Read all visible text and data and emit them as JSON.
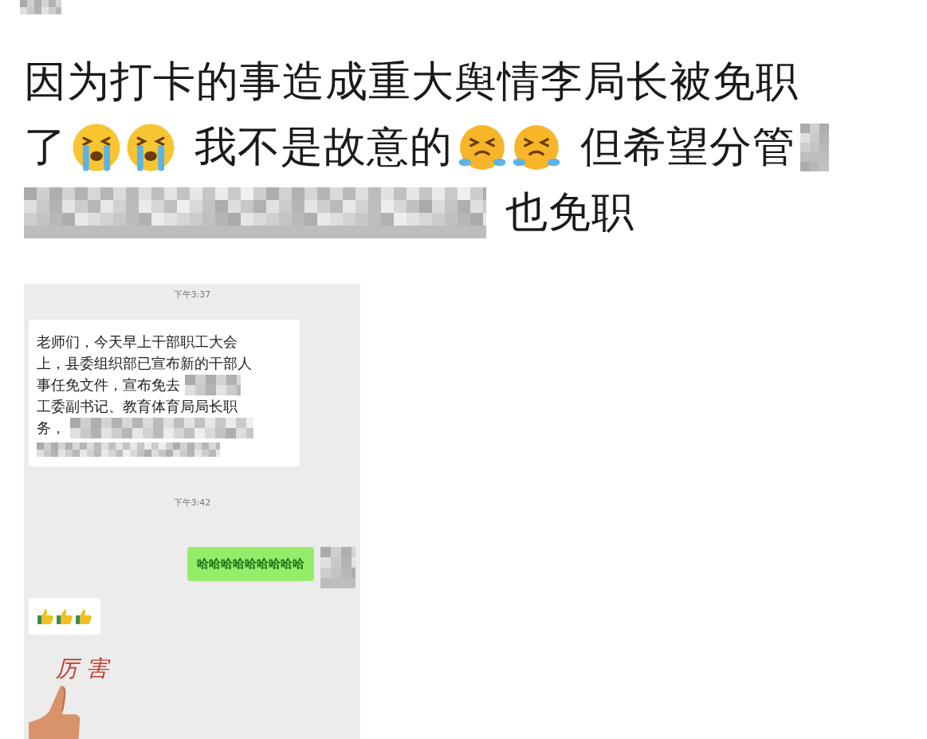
{
  "post": {
    "lines": [
      [
        {
          "kind": "text",
          "text": "因为打卡的事造成重大舆情李局长被免职"
        }
      ],
      [
        {
          "kind": "text",
          "text": "了"
        },
        {
          "kind": "crying"
        },
        {
          "kind": "crying"
        },
        {
          "kind": "text",
          "text": "我不是故意的"
        },
        {
          "kind": "laughing"
        },
        {
          "kind": "laughing"
        },
        {
          "kind": "text",
          "text": "但希望分管"
        },
        {
          "kind": "mosaic"
        }
      ],
      [
        {
          "kind": "mosaic"
        },
        {
          "kind": "text",
          "text": "也免职"
        }
      ]
    ]
  },
  "chat": {
    "messages": [
      {
        "kind": "time",
        "text": "下午3:37"
      },
      {
        "kind": "incoming",
        "lines": [
          {
            "text": "老师们，今天早上干部职工大会",
            "redacted": false
          },
          {
            "text": "上，县委组织部已宣布新的干部人",
            "redacted": false
          },
          {
            "text": "事任免文件，宣布免去",
            "redacted": true
          },
          {
            "text": "工委副书记、教育体育局局长职",
            "redacted": false
          },
          {
            "text": "务，",
            "redacted": true
          }
        ]
      },
      {
        "kind": "time",
        "text": "下午3:42"
      },
      {
        "kind": "outgoing",
        "text": "哈哈哈哈哈哈哈哈哈"
      },
      {
        "kind": "emojis",
        "emojis": [
          {
            "kind": "thumbs-up"
          },
          {
            "kind": "thumbs-up"
          },
          {
            "kind": "thumbs-up"
          }
        ]
      },
      {
        "kind": "sticker",
        "text": "厉害"
      }
    ]
  }
}
